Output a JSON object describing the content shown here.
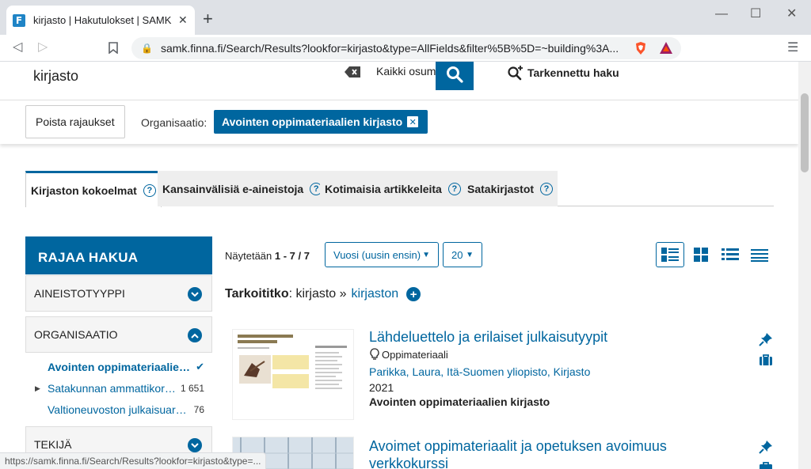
{
  "browser": {
    "tab_title": "kirjasto | Hakutulokset | SAMK Finna",
    "tab_close": "✕",
    "new_tab": "+",
    "url": "samk.finna.fi/Search/Results?lookfor=kirjasto&type=AllFields&filter%5B%5D=~building%3A...",
    "status_url": "https://samk.finna.fi/Search/Results?lookfor=kirjasto&type=..."
  },
  "search": {
    "query": "kirjasto",
    "scope": "Kaikki osumat",
    "advanced": "Tarkennettu haku"
  },
  "filters": {
    "clear_label": "Poista rajaukset",
    "org_label": "Organisaatio:",
    "org_value": "Avointen oppimateriaalien kirjasto"
  },
  "tabs": [
    {
      "label": "Kirjaston kokoelmat",
      "active": true
    },
    {
      "label": "Kansainvälisiä e-aineistoja",
      "active": false
    },
    {
      "label": "Kotimaisia artikkeleita",
      "active": false
    },
    {
      "label": "Satakirjastot",
      "active": false
    }
  ],
  "sidebar": {
    "title": "RAJAA HAKUA",
    "facets": [
      {
        "label": "AINEISTOTYYPPI"
      },
      {
        "label": "ORGANISAATIO"
      },
      {
        "label": "TEKIJÄ"
      }
    ],
    "org_items": [
      {
        "label": "Avointen oppimateriaalien kirjasto",
        "count": "✔"
      },
      {
        "label": "Satakunnan ammattikorkeakoulu",
        "count": "1 651"
      },
      {
        "label": "Valtioneuvoston julkaisuarkisto",
        "count": "76"
      }
    ]
  },
  "results": {
    "showing_prefix": "Näytetään",
    "showing_range": "1 - 7 / 7",
    "sort": "Vuosi (uusin ensin)",
    "limit": "20",
    "didyoumean_label": "Tarkoititko",
    "didyoumean_query": ": kirjasto »",
    "didyoumean_suggestion": "kirjaston",
    "records": [
      {
        "title": "Lähdeluettelo ja erilaiset julkaisutyypit",
        "format": "Oppimateriaali",
        "authors": "Parikka, Laura, Itä-Suomen yliopisto, Kirjasto",
        "year": "2021",
        "org": "Avointen oppimateriaalien kirjasto"
      },
      {
        "title": "Avoimet oppimateriaalit ja opetuksen avoimuus verkkokurssi"
      }
    ]
  },
  "colors": {
    "accent": "#00669f"
  }
}
